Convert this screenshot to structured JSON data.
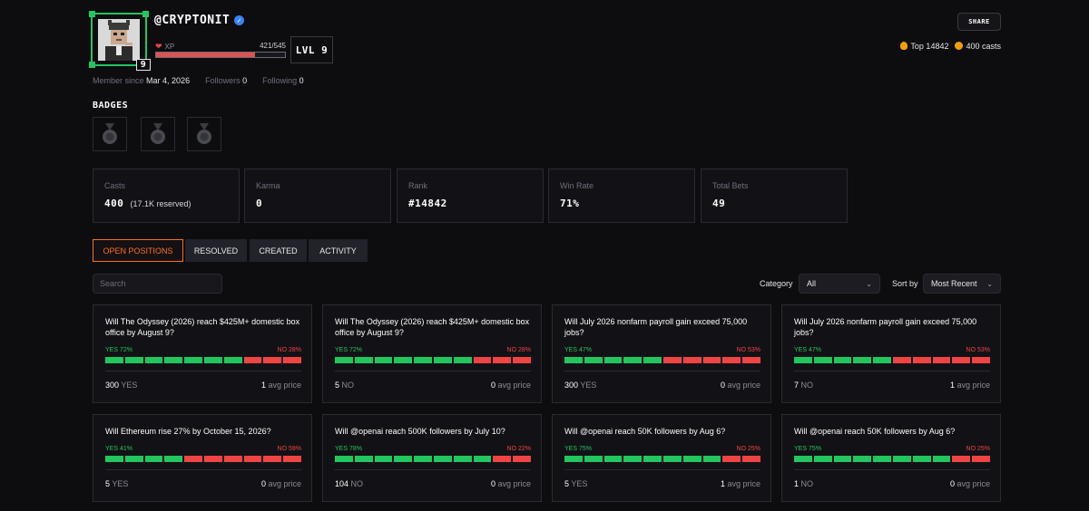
{
  "profile": {
    "username": "@CRYPTONIT",
    "level_badge": "9",
    "xp_label": "XP",
    "xp_value": "421/545",
    "xp_progress": 0.77,
    "level_label": "LVL 9",
    "share_label": "SHARE",
    "top_rank": "Top 14842",
    "casts_total": "400 casts",
    "member_since_label": "Member since",
    "member_since": "Mar 4, 2026",
    "followers_label": "Followers",
    "followers": "0",
    "following_label": "Following",
    "following": "0"
  },
  "badges": {
    "title": "BADGES",
    "items": [
      "medal-icon",
      "medal-icon",
      "medal-icon"
    ]
  },
  "stats": [
    {
      "label": "Casts",
      "value": "400",
      "sub": "(17.1K reserved)"
    },
    {
      "label": "Karma",
      "value": "0",
      "sub": ""
    },
    {
      "label": "Rank",
      "value": "#14842",
      "sub": ""
    },
    {
      "label": "Win Rate",
      "value": "71%",
      "sub": ""
    },
    {
      "label": "Total Bets",
      "value": "49",
      "sub": ""
    }
  ],
  "tabs": [
    "OPEN POSITIONS",
    "RESOLVED",
    "CREATED",
    "ACTIVITY"
  ],
  "filters": {
    "search_placeholder": "Search",
    "category_label": "Category",
    "category_value": "All",
    "sort_label": "Sort by",
    "sort_value": "Most Recent"
  },
  "colors": {
    "accent": "#f97316",
    "yes": "#22c55e",
    "no": "#ef4444"
  },
  "markets": [
    {
      "question": "Will The Odyssey (2026) reach $425M+ domestic box office by August 9?",
      "yes_label": "YES 72%",
      "no_label": "NO 28%",
      "yes_pct": 72,
      "shares": "300",
      "side": "YES",
      "avg": "1",
      "avg_label": "avg price"
    },
    {
      "question": "Will The Odyssey (2026) reach $425M+ domestic box office by August 9?",
      "yes_label": "YES 72%",
      "no_label": "NO 28%",
      "yes_pct": 72,
      "shares": "5",
      "side": "NO",
      "avg": "0",
      "avg_label": "avg price"
    },
    {
      "question": "Will July 2026 nonfarm payroll gain exceed 75,000 jobs?",
      "yes_label": "YES 47%",
      "no_label": "NO 53%",
      "yes_pct": 47,
      "shares": "300",
      "side": "YES",
      "avg": "0",
      "avg_label": "avg price"
    },
    {
      "question": "Will July 2026 nonfarm payroll gain exceed 75,000 jobs?",
      "yes_label": "YES 47%",
      "no_label": "NO 53%",
      "yes_pct": 47,
      "shares": "7",
      "side": "NO",
      "avg": "1",
      "avg_label": "avg price"
    },
    {
      "question": "Will Ethereum rise 27% by October 15, 2026?",
      "yes_label": "YES 41%",
      "no_label": "NO 59%",
      "yes_pct": 41,
      "shares": "5",
      "side": "YES",
      "avg": "0",
      "avg_label": "avg price"
    },
    {
      "question": "Will @openai reach 500K followers by July 10?",
      "yes_label": "YES 78%",
      "no_label": "NO 22%",
      "yes_pct": 78,
      "shares": "104",
      "side": "NO",
      "avg": "0",
      "avg_label": "avg price"
    },
    {
      "question": "Will @openai reach 50K followers by Aug 6?",
      "yes_label": "YES 75%",
      "no_label": "NO 25%",
      "yes_pct": 75,
      "shares": "5",
      "side": "YES",
      "avg": "1",
      "avg_label": "avg price"
    },
    {
      "question": "Will @openai reach 50K followers by Aug 6?",
      "yes_label": "YES 75%",
      "no_label": "NO 25%",
      "yes_pct": 75,
      "shares": "1",
      "side": "NO",
      "avg": "0",
      "avg_label": "avg price"
    }
  ]
}
